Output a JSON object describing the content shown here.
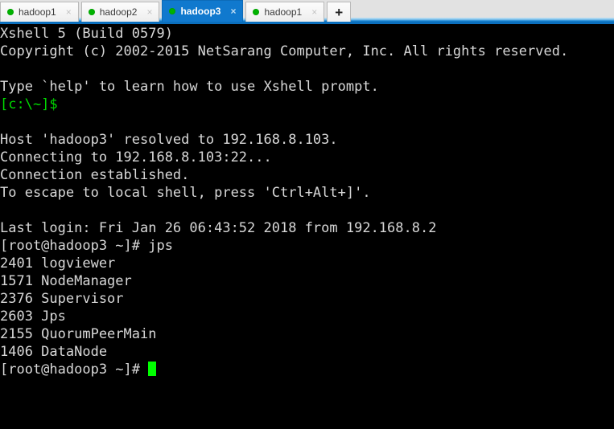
{
  "window": {
    "app_title": "Xshell 5"
  },
  "tabbar": {
    "tabs": [
      {
        "label": "hadoop1",
        "status_dot": "green-dot-icon",
        "close": "×",
        "active": false
      },
      {
        "label": "hadoop2",
        "status_dot": "green-dot-icon",
        "close": "×",
        "active": false
      },
      {
        "label": "hadoop3",
        "status_dot": "green-dot-icon",
        "close": "×",
        "active": true
      },
      {
        "label": "hadoop1",
        "status_dot": "green-dot-icon",
        "close": "×",
        "active": false
      }
    ],
    "new_tab_label": "+",
    "active_tab_bg": "#1079ce",
    "dot_color": "#00b200",
    "accent_color": "#0b6fbd"
  },
  "terminal": {
    "bg": "#000000",
    "fg": "#d8d8d8",
    "prompt_color": "#00d900",
    "cursor_color": "#00ff00",
    "lines": [
      {
        "text": "Xshell 5 (Build 0579)",
        "color": "white"
      },
      {
        "text": "Copyright (c) 2002-2015 NetSarang Computer, Inc. All rights reserved.",
        "color": "white"
      },
      {
        "text": "",
        "color": "white"
      },
      {
        "text": "Type `help' to learn how to use Xshell prompt.",
        "color": "white"
      },
      {
        "text": "[c:\\~]$",
        "color": "green"
      },
      {
        "text": "",
        "color": "white"
      },
      {
        "text": "Host 'hadoop3' resolved to 192.168.8.103.",
        "color": "white"
      },
      {
        "text": "Connecting to 192.168.8.103:22...",
        "color": "white"
      },
      {
        "text": "Connection established.",
        "color": "white"
      },
      {
        "text": "To escape to local shell, press 'Ctrl+Alt+]'.",
        "color": "white"
      },
      {
        "text": "",
        "color": "white"
      },
      {
        "text": "Last login: Fri Jan 26 06:43:52 2018 from 192.168.8.2",
        "color": "white"
      },
      {
        "text": "[root@hadoop3 ~]# jps",
        "color": "white"
      },
      {
        "text": "2401 logviewer",
        "color": "white"
      },
      {
        "text": "1571 NodeManager",
        "color": "white"
      },
      {
        "text": "2376 Supervisor",
        "color": "white"
      },
      {
        "text": "2603 Jps",
        "color": "white"
      },
      {
        "text": "2155 QuorumPeerMain",
        "color": "white"
      },
      {
        "text": "1406 DataNode",
        "color": "white"
      }
    ],
    "last_prompt": "[root@hadoop3 ~]# ",
    "command_entered": "jps",
    "host": "hadoop3",
    "host_ip": "192.168.8.103",
    "ssh_port": "22",
    "login_from_ip": "192.168.8.2",
    "jps_processes": [
      {
        "pid": "2401",
        "name": "logviewer"
      },
      {
        "pid": "1571",
        "name": "NodeManager"
      },
      {
        "pid": "2376",
        "name": "Supervisor"
      },
      {
        "pid": "2603",
        "name": "Jps"
      },
      {
        "pid": "2155",
        "name": "QuorumPeerMain"
      },
      {
        "pid": "1406",
        "name": "DataNode"
      }
    ]
  }
}
